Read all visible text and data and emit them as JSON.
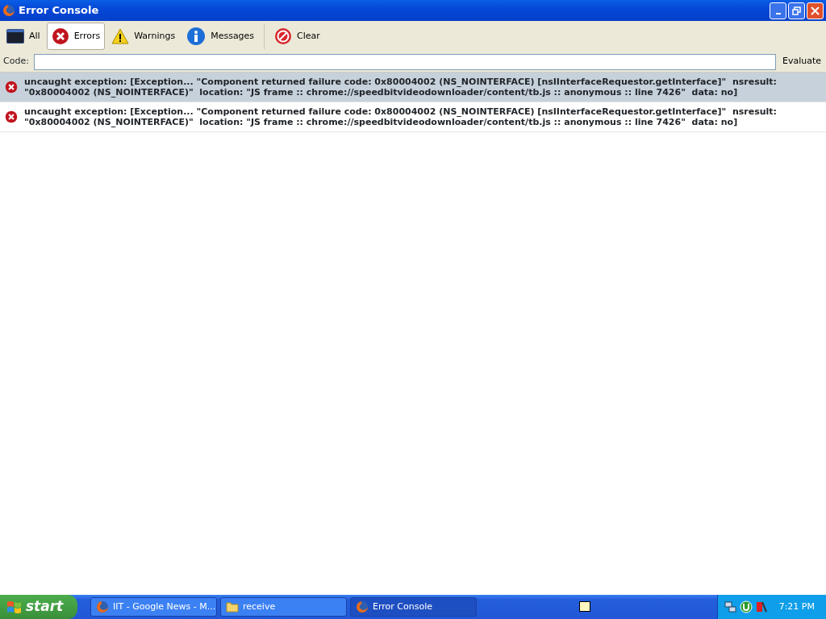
{
  "window": {
    "title": "Error Console"
  },
  "tabs": [
    {
      "label": "All",
      "kind": "all",
      "selected": false
    },
    {
      "label": "Errors",
      "kind": "error",
      "selected": true
    },
    {
      "label": "Warnings",
      "kind": "warning",
      "selected": false
    },
    {
      "label": "Messages",
      "kind": "info",
      "selected": false
    }
  ],
  "clear_button": {
    "label": "Clear"
  },
  "code_bar": {
    "label": "Code:",
    "button": "Evaluate"
  },
  "messages": [
    {
      "kind": "error",
      "selected": true,
      "text": "uncaught exception: [Exception... \"Component returned failure code: 0x80004002 (NS_NOINTERFACE) [nsIInterfaceRequestor.getInterface]\"  nsresult: \"0x80004002 (NS_NOINTERFACE)\"  location: \"JS frame :: chrome://speedbitvideodownloader/content/tb.js :: anonymous :: line 7426\"  data: no]"
    },
    {
      "kind": "error",
      "selected": false,
      "text": "uncaught exception: [Exception... \"Component returned failure code: 0x80004002 (NS_NOINTERFACE) [nsIInterfaceRequestor.getInterface]\"  nsresult: \"0x80004002 (NS_NOINTERFACE)\"  location: \"JS frame :: chrome://speedbitvideodownloader/content/tb.js :: anonymous :: line 7426\"  data: no]"
    }
  ],
  "taskbar": {
    "start": "start",
    "tasks": [
      {
        "label": "IIT - Google News - M...",
        "kind": "browser",
        "selected": false
      },
      {
        "label": "receive",
        "kind": "folder",
        "selected": false
      },
      {
        "label": "Error Console",
        "kind": "browser",
        "selected": true
      }
    ],
    "clock": "7:21 PM"
  }
}
